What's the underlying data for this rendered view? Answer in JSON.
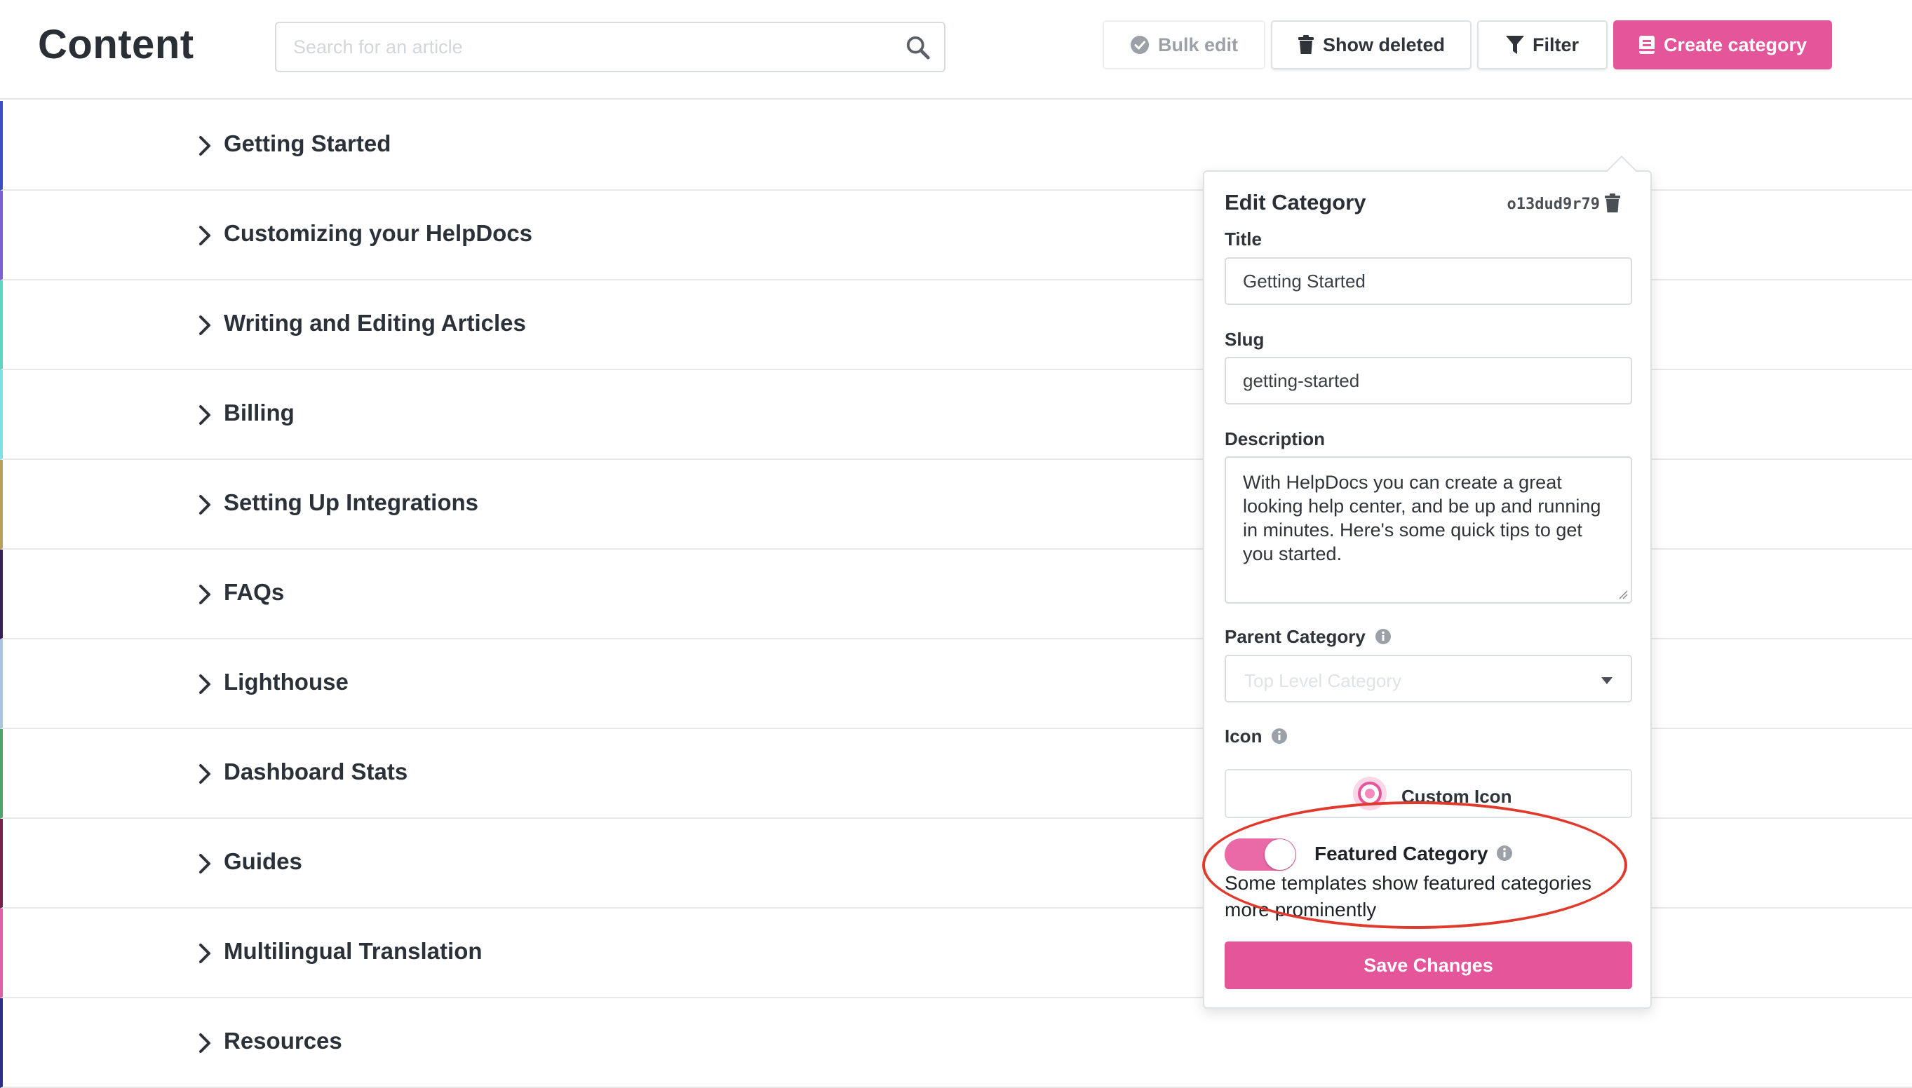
{
  "header": {
    "title": "Content",
    "search_placeholder": "Search for an article",
    "bulk_edit": "Bulk edit",
    "show_deleted": "Show deleted",
    "filter": "Filter",
    "create_category": "Create category"
  },
  "categories": [
    {
      "label": "Getting Started",
      "color": "#3c4fc2"
    },
    {
      "label": "Customizing your HelpDocs",
      "color": "#7a5fd6"
    },
    {
      "label": "Writing and Editing Articles",
      "color": "#5cd6c2"
    },
    {
      "label": "Billing",
      "color": "#7ce2e8"
    },
    {
      "label": "Setting Up Integrations",
      "color": "#b8a054"
    },
    {
      "label": "FAQs",
      "color": "#3a1e5a"
    },
    {
      "label": "Lighthouse",
      "color": "#a9c6dc"
    },
    {
      "label": "Dashboard Stats",
      "color": "#4aa56c"
    },
    {
      "label": "Guides",
      "color": "#7a1f4a"
    },
    {
      "label": "Multilingual Translation",
      "color": "#e05fa8"
    },
    {
      "label": "Resources",
      "color": "#2b2d8a"
    }
  ],
  "edit_category": {
    "heading": "Edit Category",
    "id": "o13dud9r79",
    "title_label": "Title",
    "title_value": "Getting Started",
    "slug_label": "Slug",
    "slug_value": "getting-started",
    "description_label": "Description",
    "description_value": "With HelpDocs you can create a great looking help center, and be up and running in minutes. Here's some quick tips to get you started.",
    "parent_label": "Parent Category",
    "parent_placeholder": "Top Level Category",
    "icon_label": "Icon",
    "custom_icon": "Custom Icon",
    "featured_label": "Featured Category",
    "featured_on": true,
    "featured_desc": "Some templates show featured categories more prominently",
    "save": "Save Changes"
  },
  "colors": {
    "accent": "#e4559a",
    "annotation": "#e03a2d"
  }
}
